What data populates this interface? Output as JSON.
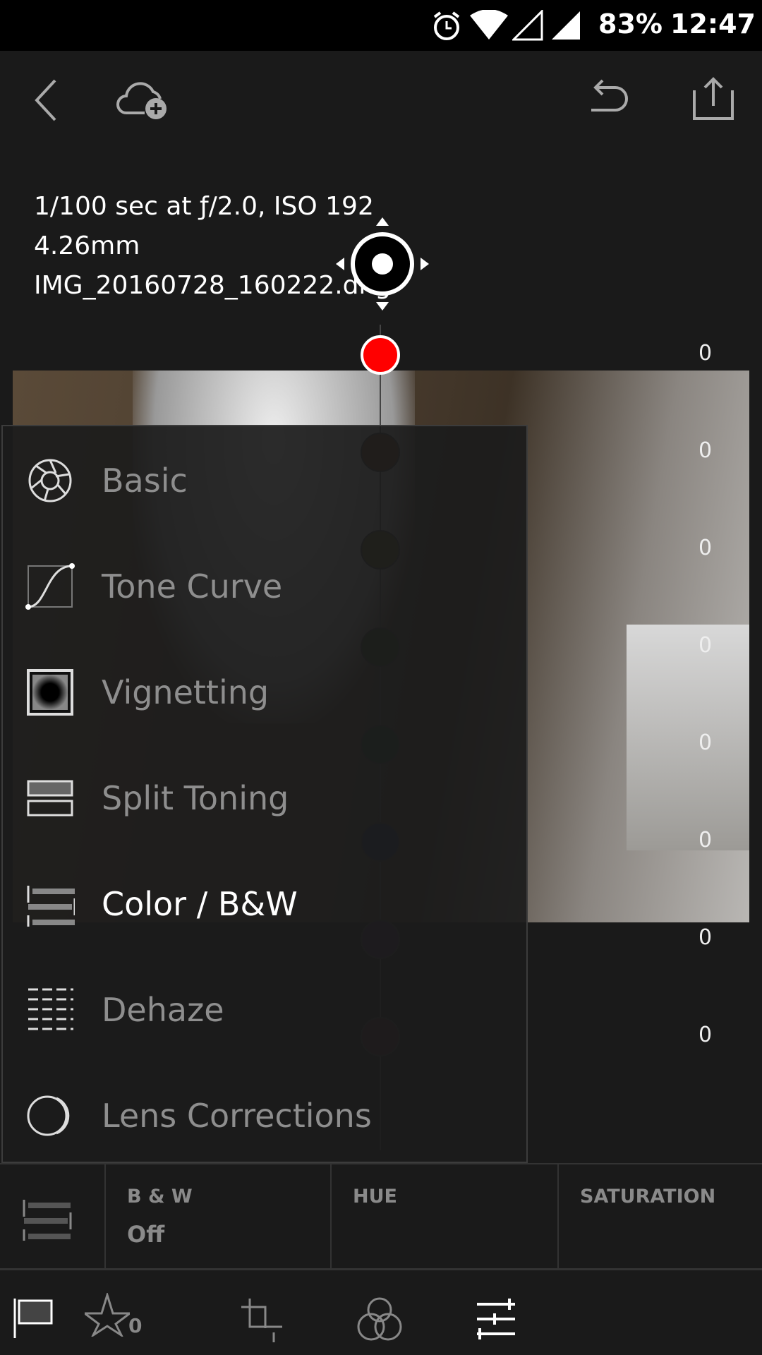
{
  "status_bar": {
    "battery": "83%",
    "time": "12:47",
    "icons": [
      "alarm-icon",
      "wifi-icon",
      "signal-empty-icon",
      "signal-icon"
    ]
  },
  "toolbar": {
    "back": "back-icon",
    "cloud": "cloud-add-icon",
    "undo": "undo-icon",
    "share": "share-icon"
  },
  "info": {
    "exposure": "1/100 sec at ƒ/2.0, ISO 192",
    "focal_length": "4.26mm",
    "filename": "IMG_20160728_160222.dng"
  },
  "sliders": {
    "values": [
      "0",
      "0",
      "0",
      "0",
      "0",
      "0",
      "0",
      "0"
    ],
    "colors": [
      "#ff0000",
      "#5a2a14",
      "#4a4512",
      "#1f3a12",
      "#143a22",
      "#1a1d44",
      "#2a1a3c",
      "#3c1422"
    ]
  },
  "menu": {
    "items": [
      {
        "label": "Basic",
        "icon": "aperture-icon"
      },
      {
        "label": "Tone Curve",
        "icon": "tone-curve-icon"
      },
      {
        "label": "Vignetting",
        "icon": "vignette-icon"
      },
      {
        "label": "Split Toning",
        "icon": "split-toning-icon"
      },
      {
        "label": "Color / B&W",
        "icon": "color-bw-icon",
        "active": true
      },
      {
        "label": "Dehaze",
        "icon": "dehaze-icon"
      },
      {
        "label": "Lens Corrections",
        "icon": "lens-icon"
      }
    ]
  },
  "panel": {
    "bw_label": "B & W",
    "bw_value": "Off",
    "hue_label": "HUE",
    "saturation_label": "SATURATION"
  },
  "bottom": {
    "rating": "0"
  }
}
